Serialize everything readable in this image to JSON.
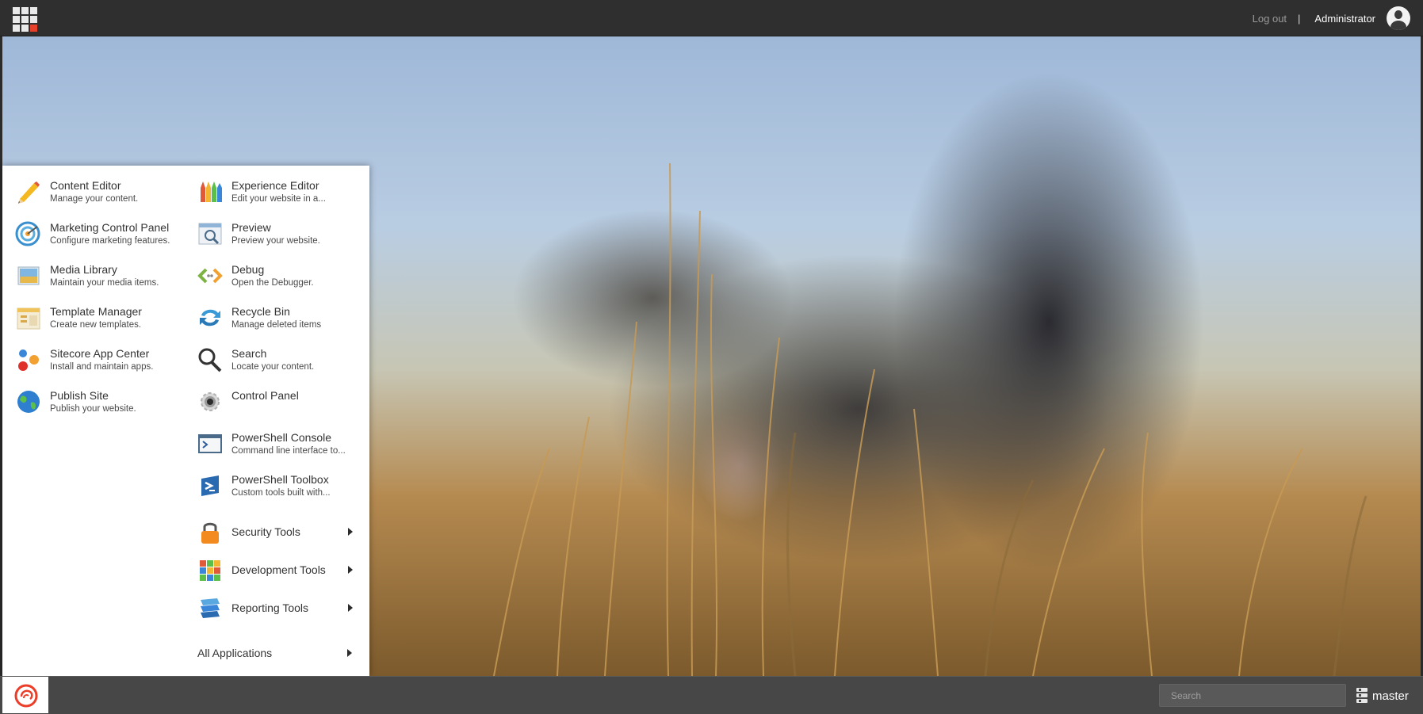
{
  "header": {
    "logout_label": "Log out",
    "separator": "|",
    "username": "Administrator"
  },
  "start_menu": {
    "left_column": [
      {
        "title": "Content Editor",
        "description": "Manage your content.",
        "icon": "pencil-icon"
      },
      {
        "title": "Marketing Control Panel",
        "description": "Configure marketing features.",
        "icon": "target-icon"
      },
      {
        "title": "Media Library",
        "description": "Maintain your media items.",
        "icon": "image-icon"
      },
      {
        "title": "Template Manager",
        "description": "Create new templates.",
        "icon": "template-icon"
      },
      {
        "title": "Sitecore App Center",
        "description": "Install and maintain apps.",
        "icon": "app-center-icon"
      },
      {
        "title": "Publish Site",
        "description": "Publish your website.",
        "icon": "globe-icon"
      }
    ],
    "right_column": [
      {
        "title": "Experience Editor",
        "description": "Edit your website in a...",
        "icon": "crayons-icon"
      },
      {
        "title": "Preview",
        "description": "Preview your website.",
        "icon": "preview-icon"
      },
      {
        "title": "Debug",
        "description": "Open the Debugger.",
        "icon": "debug-icon"
      },
      {
        "title": "Recycle Bin",
        "description": "Manage deleted items",
        "icon": "recycle-icon"
      },
      {
        "title": "Search",
        "description": "Locate your content.",
        "icon": "search-icon"
      },
      {
        "title": "Control Panel",
        "description": "",
        "icon": "gear-icon"
      },
      {
        "title": "PowerShell Console",
        "description": "Command line interface to...",
        "icon": "console-icon"
      },
      {
        "title": "PowerShell Toolbox",
        "description": "Custom tools built with...",
        "icon": "toolbox-icon"
      }
    ],
    "submenus": [
      {
        "title": "Security Tools",
        "icon": "lock-icon"
      },
      {
        "title": "Development Tools",
        "icon": "cubes-icon"
      },
      {
        "title": "Reporting Tools",
        "icon": "reports-icon"
      }
    ],
    "all_applications_label": "All Applications"
  },
  "taskbar": {
    "search_placeholder": "Search",
    "database_label": "master"
  },
  "colors": {
    "topbar": "#2f2f2f",
    "taskbar": "#474747",
    "accent_red": "#e6402a"
  }
}
